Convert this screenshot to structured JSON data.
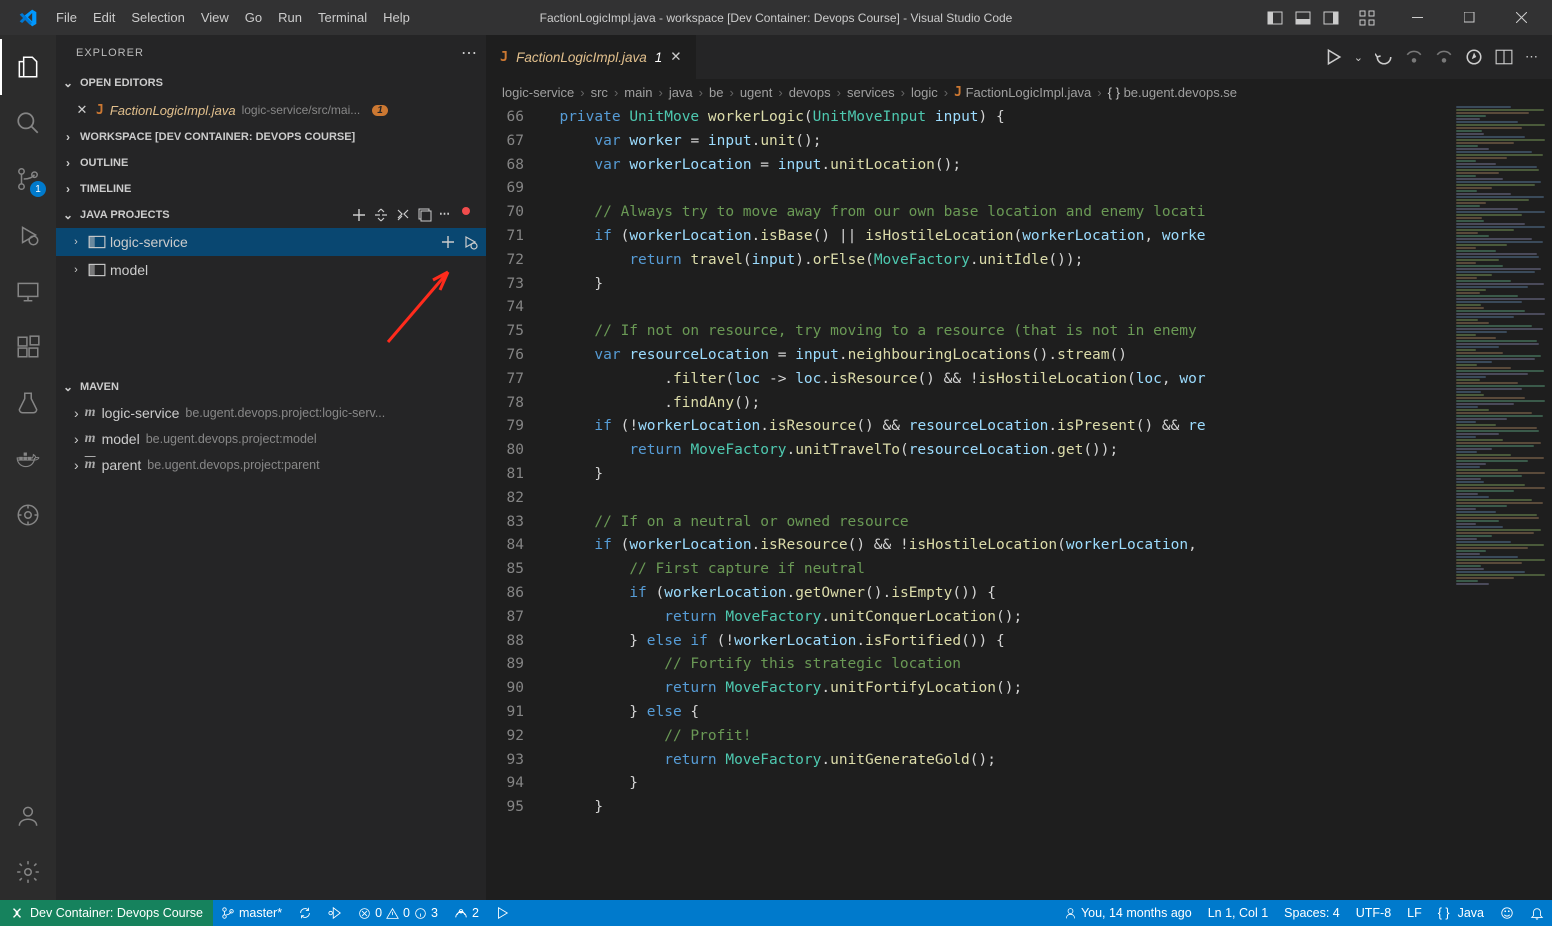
{
  "title": "FactionLogicImpl.java - workspace [Dev Container: Devops Course] - Visual Studio Code",
  "menu": [
    "File",
    "Edit",
    "Selection",
    "View",
    "Go",
    "Run",
    "Terminal",
    "Help"
  ],
  "sidebar": {
    "title": "EXPLORER",
    "openEditors": "OPEN EDITORS",
    "openFile": "FactionLogicImpl.java",
    "openPath": "logic-service/src/mai...",
    "dirty": "1",
    "workspace": "WORKSPACE [DEV CONTAINER: DEVOPS COURSE]",
    "outline": "OUTLINE",
    "timeline": "TIMELINE",
    "javaProjects": "JAVA PROJECTS",
    "proj1": "logic-service",
    "proj2": "model",
    "maven": "MAVEN",
    "m1": "logic-service",
    "m1desc": "be.ugent.devops.project:logic-serv...",
    "m2": "model",
    "m2desc": "be.ugent.devops.project:model",
    "m3": "parent",
    "m3desc": "be.ugent.devops.project:parent"
  },
  "tab": {
    "label": "FactionLogicImpl.java",
    "dirty": "1"
  },
  "breadcrumb": {
    "p0": "logic-service",
    "p1": "src",
    "p2": "main",
    "p3": "java",
    "p4": "be",
    "p5": "ugent",
    "p6": "devops",
    "p7": "services",
    "p8": "logic",
    "p9": "FactionLogicImpl.java",
    "p10": "be.ugent.devops.se"
  },
  "scm_badge": "1",
  "status": {
    "remote": "Dev Container: Devops Course",
    "branch": "master*",
    "errors": "0",
    "warnings": "0",
    "infos": "3",
    "ports": "2",
    "blame": "You, 14 months ago",
    "ln": "Ln 1, Col 1",
    "spaces": "Spaces: 4",
    "enc": "UTF-8",
    "eol": "LF",
    "lang": "Java"
  },
  "code": {
    "startLine": 66,
    "lines": [
      [
        [
          "  ",
          "pun"
        ],
        [
          "private",
          "kw"
        ],
        [
          " ",
          "pun"
        ],
        [
          "UnitMove",
          "type"
        ],
        [
          " ",
          "pun"
        ],
        [
          "workerLogic",
          "func"
        ],
        [
          "(",
          "pun"
        ],
        [
          "UnitMoveInput",
          "type"
        ],
        [
          " ",
          "pun"
        ],
        [
          "input",
          "param"
        ],
        [
          ") {",
          "pun"
        ]
      ],
      [
        [
          "      ",
          "pun"
        ],
        [
          "var",
          "kw"
        ],
        [
          " ",
          "pun"
        ],
        [
          "worker",
          "var"
        ],
        [
          " = ",
          "pun"
        ],
        [
          "input",
          "var"
        ],
        [
          ".",
          "pun"
        ],
        [
          "unit",
          "func"
        ],
        [
          "();",
          "pun"
        ]
      ],
      [
        [
          "      ",
          "pun"
        ],
        [
          "var",
          "kw"
        ],
        [
          " ",
          "pun"
        ],
        [
          "workerLocation",
          "var"
        ],
        [
          " = ",
          "pun"
        ],
        [
          "input",
          "var"
        ],
        [
          ".",
          "pun"
        ],
        [
          "unitLocation",
          "func"
        ],
        [
          "();",
          "pun"
        ]
      ],
      [],
      [
        [
          "      ",
          "pun"
        ],
        [
          "// Always try to move away from our own base location and enemy locati",
          "comment"
        ]
      ],
      [
        [
          "      ",
          "pun"
        ],
        [
          "if",
          "kw"
        ],
        [
          " (",
          "pun"
        ],
        [
          "workerLocation",
          "var"
        ],
        [
          ".",
          "pun"
        ],
        [
          "isBase",
          "func"
        ],
        [
          "() || ",
          "pun"
        ],
        [
          "isHostileLocation",
          "func"
        ],
        [
          "(",
          "pun"
        ],
        [
          "workerLocation",
          "var"
        ],
        [
          ", ",
          "pun"
        ],
        [
          "worke",
          "var"
        ]
      ],
      [
        [
          "          ",
          "pun"
        ],
        [
          "return",
          "kw"
        ],
        [
          " ",
          "pun"
        ],
        [
          "travel",
          "func"
        ],
        [
          "(",
          "pun"
        ],
        [
          "input",
          "var"
        ],
        [
          ").",
          "pun"
        ],
        [
          "orElse",
          "func"
        ],
        [
          "(",
          "pun"
        ],
        [
          "MoveFactory",
          "type"
        ],
        [
          ".",
          "pun"
        ],
        [
          "unitIdle",
          "func"
        ],
        [
          "());",
          "pun"
        ]
      ],
      [
        [
          "      }",
          "pun"
        ]
      ],
      [],
      [
        [
          "      ",
          "pun"
        ],
        [
          "// If not on resource, try moving to a resource (that is not in enemy ",
          "comment"
        ]
      ],
      [
        [
          "      ",
          "pun"
        ],
        [
          "var",
          "kw"
        ],
        [
          " ",
          "pun"
        ],
        [
          "resourceLocation",
          "var"
        ],
        [
          " = ",
          "pun"
        ],
        [
          "input",
          "var"
        ],
        [
          ".",
          "pun"
        ],
        [
          "neighbouringLocations",
          "func"
        ],
        [
          "().",
          "pun"
        ],
        [
          "stream",
          "func"
        ],
        [
          "()",
          "pun"
        ]
      ],
      [
        [
          "              .",
          "pun"
        ],
        [
          "filter",
          "func"
        ],
        [
          "(",
          "pun"
        ],
        [
          "loc",
          "param"
        ],
        [
          " -> ",
          "pun"
        ],
        [
          "loc",
          "var"
        ],
        [
          ".",
          "pun"
        ],
        [
          "isResource",
          "func"
        ],
        [
          "() && !",
          "pun"
        ],
        [
          "isHostileLocation",
          "func"
        ],
        [
          "(",
          "pun"
        ],
        [
          "loc",
          "var"
        ],
        [
          ", ",
          "pun"
        ],
        [
          "wor",
          "var"
        ]
      ],
      [
        [
          "              .",
          "pun"
        ],
        [
          "findAny",
          "func"
        ],
        [
          "();",
          "pun"
        ]
      ],
      [
        [
          "      ",
          "pun"
        ],
        [
          "if",
          "kw"
        ],
        [
          " (!",
          "pun"
        ],
        [
          "workerLocation",
          "var"
        ],
        [
          ".",
          "pun"
        ],
        [
          "isResource",
          "func"
        ],
        [
          "() && ",
          "pun"
        ],
        [
          "resourceLocation",
          "var"
        ],
        [
          ".",
          "pun"
        ],
        [
          "isPresent",
          "func"
        ],
        [
          "() && ",
          "pun"
        ],
        [
          "re",
          "var"
        ]
      ],
      [
        [
          "          ",
          "pun"
        ],
        [
          "return",
          "kw"
        ],
        [
          " ",
          "pun"
        ],
        [
          "MoveFactory",
          "type"
        ],
        [
          ".",
          "pun"
        ],
        [
          "unitTravelTo",
          "func"
        ],
        [
          "(",
          "pun"
        ],
        [
          "resourceLocation",
          "var"
        ],
        [
          ".",
          "pun"
        ],
        [
          "get",
          "func"
        ],
        [
          "());",
          "pun"
        ]
      ],
      [
        [
          "      }",
          "pun"
        ]
      ],
      [],
      [
        [
          "      ",
          "pun"
        ],
        [
          "// If on a neutral or owned resource",
          "comment"
        ]
      ],
      [
        [
          "      ",
          "pun"
        ],
        [
          "if",
          "kw"
        ],
        [
          " (",
          "pun"
        ],
        [
          "workerLocation",
          "var"
        ],
        [
          ".",
          "pun"
        ],
        [
          "isResource",
          "func"
        ],
        [
          "() && !",
          "pun"
        ],
        [
          "isHostileLocation",
          "func"
        ],
        [
          "(",
          "pun"
        ],
        [
          "workerLocation",
          "var"
        ],
        [
          ", ",
          "pun"
        ]
      ],
      [
        [
          "          ",
          "pun"
        ],
        [
          "// First capture if neutral",
          "comment"
        ]
      ],
      [
        [
          "          ",
          "pun"
        ],
        [
          "if",
          "kw"
        ],
        [
          " (",
          "pun"
        ],
        [
          "workerLocation",
          "var"
        ],
        [
          ".",
          "pun"
        ],
        [
          "getOwner",
          "func"
        ],
        [
          "().",
          "pun"
        ],
        [
          "isEmpty",
          "func"
        ],
        [
          "()) {",
          "pun"
        ]
      ],
      [
        [
          "              ",
          "pun"
        ],
        [
          "return",
          "kw"
        ],
        [
          " ",
          "pun"
        ],
        [
          "MoveFactory",
          "type"
        ],
        [
          ".",
          "pun"
        ],
        [
          "unitConquerLocation",
          "func"
        ],
        [
          "();",
          "pun"
        ]
      ],
      [
        [
          "          } ",
          "pun"
        ],
        [
          "else",
          "kw"
        ],
        [
          " ",
          "pun"
        ],
        [
          "if",
          "kw"
        ],
        [
          " (!",
          "pun"
        ],
        [
          "workerLocation",
          "var"
        ],
        [
          ".",
          "pun"
        ],
        [
          "isFortified",
          "func"
        ],
        [
          "()) {",
          "pun"
        ]
      ],
      [
        [
          "              ",
          "pun"
        ],
        [
          "// Fortify this strategic location",
          "comment"
        ]
      ],
      [
        [
          "              ",
          "pun"
        ],
        [
          "return",
          "kw"
        ],
        [
          " ",
          "pun"
        ],
        [
          "MoveFactory",
          "type"
        ],
        [
          ".",
          "pun"
        ],
        [
          "unitFortifyLocation",
          "func"
        ],
        [
          "();",
          "pun"
        ]
      ],
      [
        [
          "          } ",
          "pun"
        ],
        [
          "else",
          "kw"
        ],
        [
          " {",
          "pun"
        ]
      ],
      [
        [
          "              ",
          "pun"
        ],
        [
          "// Profit!",
          "comment"
        ]
      ],
      [
        [
          "              ",
          "pun"
        ],
        [
          "return",
          "kw"
        ],
        [
          " ",
          "pun"
        ],
        [
          "MoveFactory",
          "type"
        ],
        [
          ".",
          "pun"
        ],
        [
          "unitGenerateGold",
          "func"
        ],
        [
          "();",
          "pun"
        ]
      ],
      [
        [
          "          }",
          "pun"
        ]
      ],
      [
        [
          "      }",
          "pun"
        ]
      ]
    ]
  }
}
